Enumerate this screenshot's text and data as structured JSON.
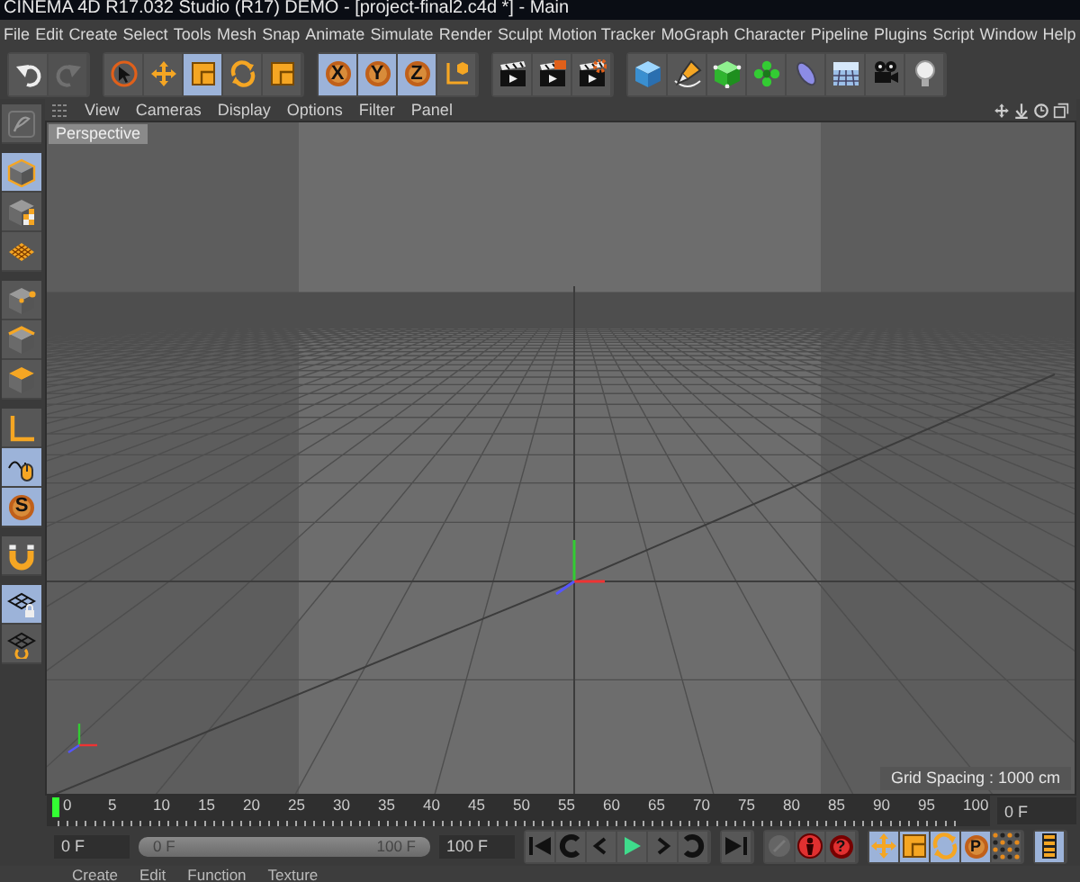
{
  "window": {
    "title": "CINEMA 4D R17.032 Studio (R17) DEMO - [project-final2.c4d *] - Main"
  },
  "menu_bar": [
    "File",
    "Edit",
    "Create",
    "Select",
    "Tools",
    "Mesh",
    "Snap",
    "Animate",
    "Simulate",
    "Render",
    "Sculpt",
    "Motion Tracker",
    "MoGraph",
    "Character",
    "Pipeline",
    "Plugins",
    "Script",
    "Window",
    "Help"
  ],
  "toolbar": {
    "groups": [
      [
        {
          "kind": "undo",
          "selected": false,
          "disabled": false
        },
        {
          "kind": "redo",
          "selected": false,
          "disabled": true
        }
      ],
      [
        {
          "kind": "live-selection",
          "selected": false,
          "disabled": false
        },
        {
          "kind": "move",
          "selected": false,
          "disabled": false
        },
        {
          "kind": "scale",
          "selected": true,
          "disabled": false
        },
        {
          "kind": "rotate",
          "selected": false,
          "disabled": false
        },
        {
          "kind": "recent-tool",
          "selected": false,
          "disabled": false
        }
      ],
      [
        {
          "kind": "axis-lock",
          "label": "X",
          "selected": true,
          "disabled": false
        },
        {
          "kind": "axis-lock",
          "label": "Y",
          "selected": true,
          "disabled": false
        },
        {
          "kind": "axis-lock",
          "label": "Z",
          "selected": true,
          "disabled": false
        },
        {
          "kind": "coordinate-system",
          "selected": false,
          "disabled": false
        }
      ],
      [
        {
          "kind": "render-view",
          "selected": false,
          "disabled": false
        },
        {
          "kind": "render-picture",
          "selected": false,
          "disabled": false
        },
        {
          "kind": "render-settings",
          "selected": false,
          "disabled": false
        }
      ],
      [
        {
          "kind": "cube",
          "selected": false,
          "disabled": false
        },
        {
          "kind": "pen",
          "selected": false,
          "disabled": false
        },
        {
          "kind": "subdivision",
          "selected": false,
          "disabled": false
        },
        {
          "kind": "cloner",
          "selected": false,
          "disabled": false
        },
        {
          "kind": "deformer",
          "selected": false,
          "disabled": false
        },
        {
          "kind": "floor",
          "selected": false,
          "disabled": false
        },
        {
          "kind": "camera",
          "selected": false,
          "disabled": false
        },
        {
          "kind": "light",
          "selected": false,
          "disabled": false
        }
      ]
    ]
  },
  "sidebar": {
    "groups": [
      [
        {
          "kind": "layout",
          "selected": false
        }
      ],
      [
        {
          "kind": "model",
          "selected": true
        },
        {
          "kind": "texture",
          "selected": false
        },
        {
          "kind": "texture-axis",
          "selected": false
        }
      ],
      [
        {
          "kind": "points",
          "selected": false
        },
        {
          "kind": "edges",
          "selected": false
        },
        {
          "kind": "polygons",
          "selected": false
        }
      ],
      [
        {
          "kind": "axis",
          "selected": false
        },
        {
          "kind": "tweak",
          "selected": true
        },
        {
          "kind": "solo",
          "label": "S",
          "selected": true
        }
      ],
      [
        {
          "kind": "snap",
          "selected": false
        }
      ],
      [
        {
          "kind": "workplane",
          "selected": true
        },
        {
          "kind": "workplane-lock",
          "selected": false
        }
      ]
    ]
  },
  "viewport": {
    "menu": [
      "View",
      "Cameras",
      "Display",
      "Options",
      "Filter",
      "Panel"
    ],
    "camera": "Perspective",
    "grid_spacing": "Grid Spacing : 1000 cm"
  },
  "timeline": {
    "ticks": [
      "0",
      "5",
      "10",
      "15",
      "20",
      "25",
      "30",
      "35",
      "40",
      "45",
      "50",
      "55",
      "60",
      "65",
      "70",
      "75",
      "80",
      "85",
      "90",
      "95",
      "100"
    ],
    "playhead": {
      "level": 0
    },
    "current_frame": "0 F"
  },
  "playback": {
    "start_field": "0 F",
    "range": {
      "start": "0 F",
      "end": "100 F",
      "level": 1
    },
    "end_field": "100 F",
    "groups": [
      [
        {
          "kind": "go-start",
          "selected": false,
          "disabled": false
        },
        {
          "kind": "prev-key",
          "selected": false,
          "disabled": false
        },
        {
          "kind": "prev-frame",
          "selected": false,
          "disabled": false
        },
        {
          "kind": "play",
          "selected": false,
          "disabled": false
        },
        {
          "kind": "next-frame",
          "selected": false,
          "disabled": false
        },
        {
          "kind": "next-key",
          "selected": false,
          "disabled": false
        }
      ],
      [
        {
          "kind": "go-end",
          "selected": false,
          "disabled": false
        }
      ],
      [
        {
          "kind": "record-key",
          "selected": false,
          "disabled": true
        },
        {
          "kind": "record",
          "selected": false,
          "disabled": false
        },
        {
          "kind": "autokey",
          "label": "?",
          "selected": false,
          "disabled": false
        }
      ],
      [
        {
          "kind": "move",
          "selected": true,
          "disabled": false
        },
        {
          "kind": "scale",
          "selected": true,
          "disabled": false
        },
        {
          "kind": "rotate",
          "selected": true,
          "disabled": false
        },
        {
          "kind": "param",
          "label": "P",
          "selected": true,
          "disabled": false
        },
        {
          "kind": "points",
          "selected": false,
          "disabled": false
        }
      ],
      [
        {
          "kind": "timeline",
          "selected": true,
          "disabled": false
        }
      ]
    ]
  },
  "material_menu": [
    "Create",
    "Edit",
    "Function",
    "Texture"
  ]
}
